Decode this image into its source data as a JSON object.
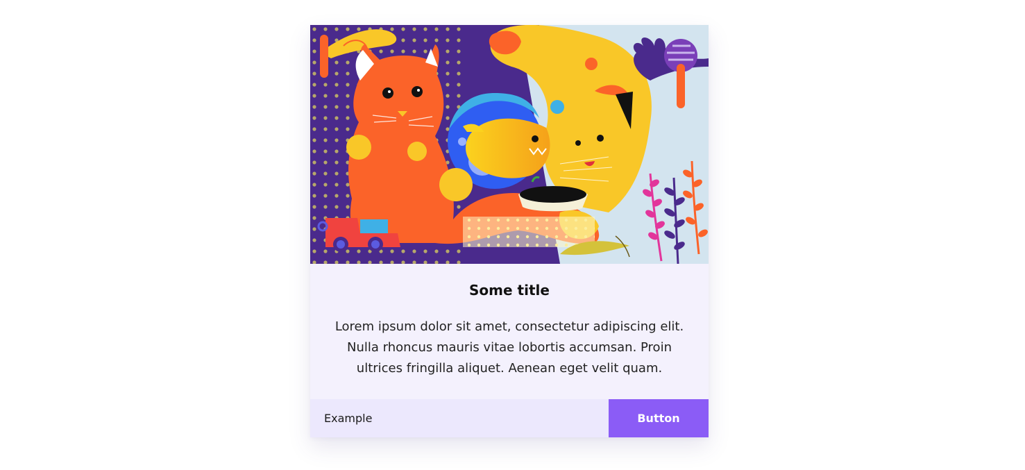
{
  "card": {
    "image_alt": "Illustration of cats, a fish bowl, a toy truck and plants",
    "title": "Some title",
    "text": "Lorem ipsum dolor sit amet, consectetur adipiscing elit. Nulla rhoncus mauris vitae lobortis accumsan. Proin ultrices fringilla aliquet. Aenean eget velit quam.",
    "footer_label": "Example",
    "button_label": "Button"
  },
  "colors": {
    "page_background": "#ffffff",
    "card_background": "#f4f1fd",
    "footer_background": "#ece8fd",
    "button_background": "#8b5cf6",
    "illustration_purple": "#4a2a8c",
    "illustration_orange": "#fb6329",
    "illustration_yellow": "#f9c728",
    "illustration_blue": "#2f5ef2",
    "illustration_sky": "#d3e4ef"
  }
}
